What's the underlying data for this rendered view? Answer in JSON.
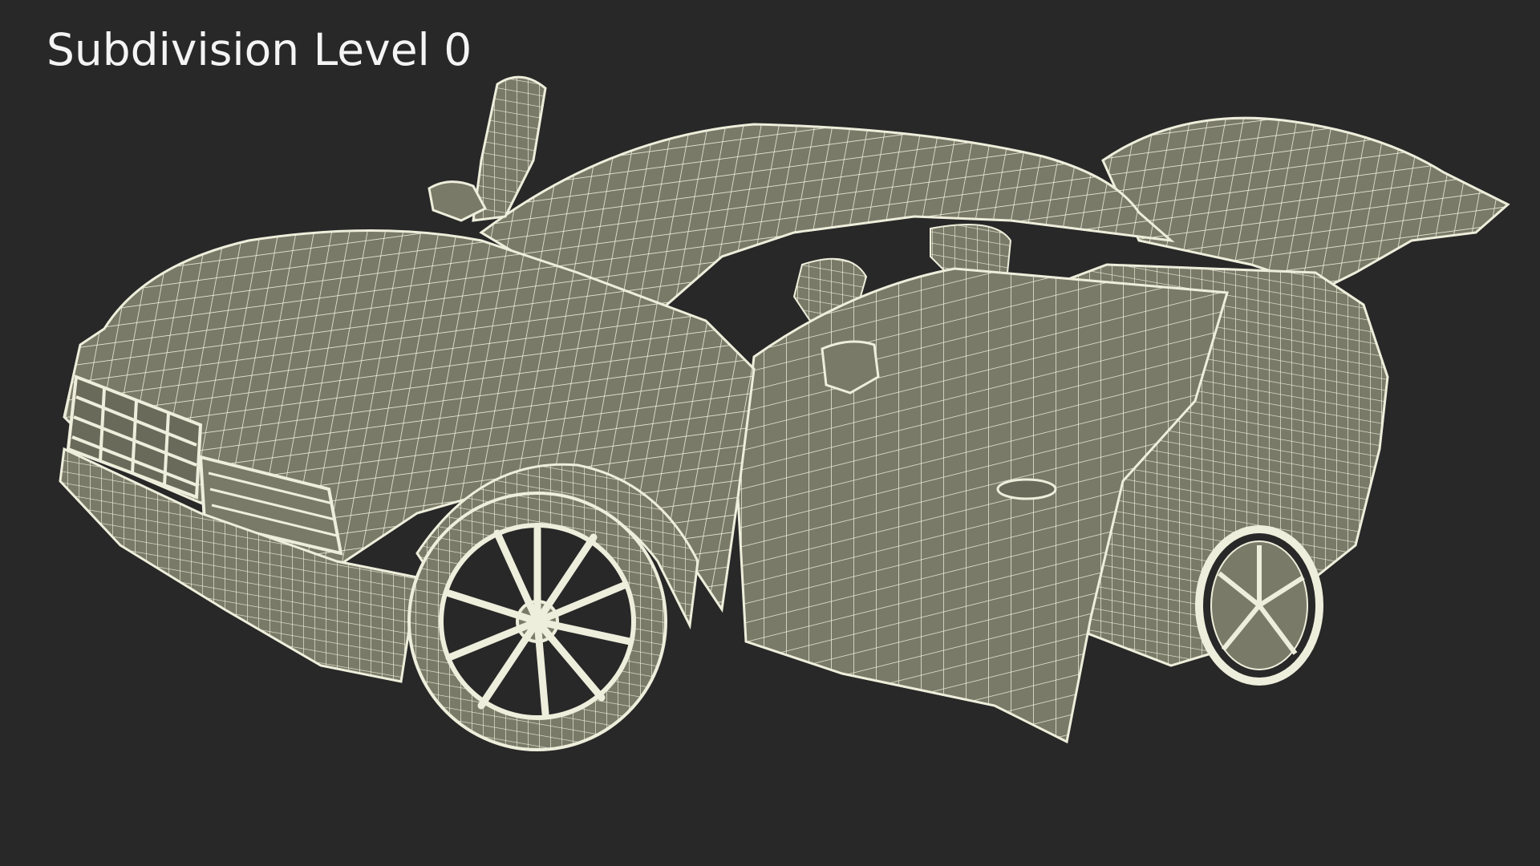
{
  "overlay": {
    "title": "Subdivision Level 0"
  },
  "colors": {
    "background": "#282828",
    "surface": "#7a7a68",
    "wire": "#eeeedc",
    "text": "#f4f4f4"
  },
  "subject": {
    "icon": "car-wireframe-icon"
  }
}
